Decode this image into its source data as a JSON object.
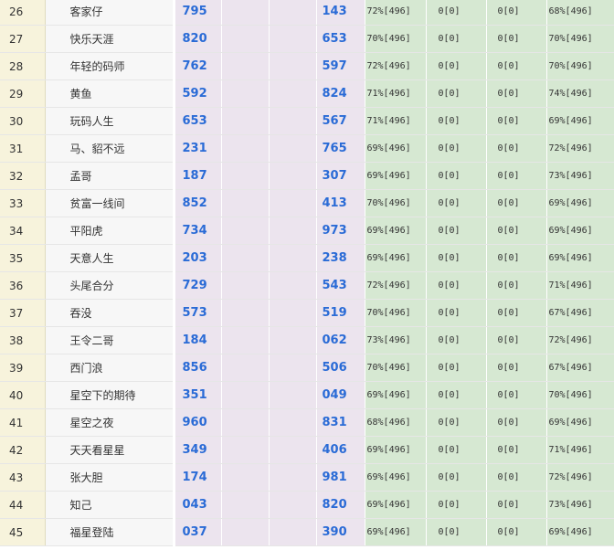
{
  "rows": [
    {
      "rank": "26",
      "name": "客家仔",
      "n1": "795",
      "n2": "143",
      "p1": "72%[496]",
      "z1": "0[0]",
      "z2": "0[0]",
      "p2": "68%[496]"
    },
    {
      "rank": "27",
      "name": "快乐天涯",
      "n1": "820",
      "n2": "653",
      "p1": "70%[496]",
      "z1": "0[0]",
      "z2": "0[0]",
      "p2": "70%[496]"
    },
    {
      "rank": "28",
      "name": "年轻的码师",
      "n1": "762",
      "n2": "597",
      "p1": "72%[496]",
      "z1": "0[0]",
      "z2": "0[0]",
      "p2": "70%[496]"
    },
    {
      "rank": "29",
      "name": "黄鱼",
      "n1": "592",
      "n2": "824",
      "p1": "71%[496]",
      "z1": "0[0]",
      "z2": "0[0]",
      "p2": "74%[496]"
    },
    {
      "rank": "30",
      "name": "玩码人生",
      "n1": "653",
      "n2": "567",
      "p1": "71%[496]",
      "z1": "0[0]",
      "z2": "0[0]",
      "p2": "69%[496]"
    },
    {
      "rank": "31",
      "name": "马、貂不远",
      "n1": "231",
      "n2": "765",
      "p1": "69%[496]",
      "z1": "0[0]",
      "z2": "0[0]",
      "p2": "72%[496]"
    },
    {
      "rank": "32",
      "name": "孟哥",
      "n1": "187",
      "n2": "307",
      "p1": "69%[496]",
      "z1": "0[0]",
      "z2": "0[0]",
      "p2": "73%[496]"
    },
    {
      "rank": "33",
      "name": "贫富一线间",
      "n1": "852",
      "n2": "413",
      "p1": "70%[496]",
      "z1": "0[0]",
      "z2": "0[0]",
      "p2": "69%[496]"
    },
    {
      "rank": "34",
      "name": "平阳虎",
      "n1": "734",
      "n2": "973",
      "p1": "69%[496]",
      "z1": "0[0]",
      "z2": "0[0]",
      "p2": "69%[496]"
    },
    {
      "rank": "35",
      "name": "天意人生",
      "n1": "203",
      "n2": "238",
      "p1": "69%[496]",
      "z1": "0[0]",
      "z2": "0[0]",
      "p2": "69%[496]"
    },
    {
      "rank": "36",
      "name": "头尾合分",
      "n1": "729",
      "n2": "543",
      "p1": "72%[496]",
      "z1": "0[0]",
      "z2": "0[0]",
      "p2": "71%[496]"
    },
    {
      "rank": "37",
      "name": "吞没",
      "n1": "573",
      "n2": "519",
      "p1": "70%[496]",
      "z1": "0[0]",
      "z2": "0[0]",
      "p2": "67%[496]"
    },
    {
      "rank": "38",
      "name": "王令二哥",
      "n1": "184",
      "n2": "062",
      "p1": "73%[496]",
      "z1": "0[0]",
      "z2": "0[0]",
      "p2": "72%[496]"
    },
    {
      "rank": "39",
      "name": "西门浪",
      "n1": "856",
      "n2": "506",
      "p1": "70%[496]",
      "z1": "0[0]",
      "z2": "0[0]",
      "p2": "67%[496]"
    },
    {
      "rank": "40",
      "name": "星空下的期待",
      "n1": "351",
      "n2": "049",
      "p1": "69%[496]",
      "z1": "0[0]",
      "z2": "0[0]",
      "p2": "70%[496]"
    },
    {
      "rank": "41",
      "name": "星空之夜",
      "n1": "960",
      "n2": "831",
      "p1": "68%[496]",
      "z1": "0[0]",
      "z2": "0[0]",
      "p2": "69%[496]"
    },
    {
      "rank": "42",
      "name": "天天看星星",
      "n1": "349",
      "n2": "406",
      "p1": "69%[496]",
      "z1": "0[0]",
      "z2": "0[0]",
      "p2": "71%[496]"
    },
    {
      "rank": "43",
      "name": "张大胆",
      "n1": "174",
      "n2": "981",
      "p1": "69%[496]",
      "z1": "0[0]",
      "z2": "0[0]",
      "p2": "72%[496]"
    },
    {
      "rank": "44",
      "name": "知己",
      "n1": "043",
      "n2": "820",
      "p1": "69%[496]",
      "z1": "0[0]",
      "z2": "0[0]",
      "p2": "73%[496]"
    },
    {
      "rank": "45",
      "name": "福星登陆",
      "n1": "037",
      "n2": "390",
      "p1": "69%[496]",
      "z1": "0[0]",
      "z2": "0[0]",
      "p2": "69%[496]"
    }
  ]
}
